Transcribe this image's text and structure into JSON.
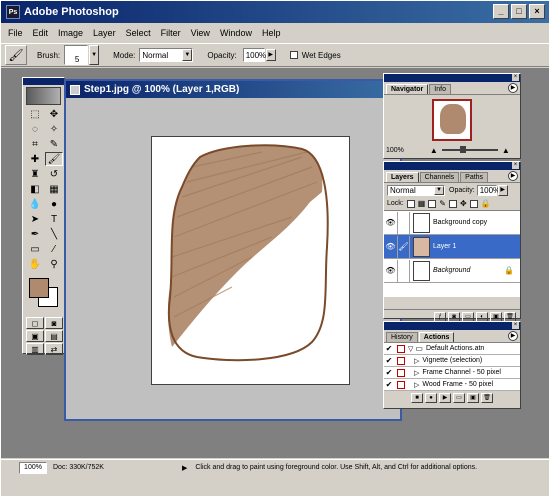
{
  "app": {
    "title": "Adobe Photoshop",
    "icon_label": "Ps"
  },
  "window_buttons": [
    "_",
    "□",
    "×"
  ],
  "menu": [
    "File",
    "Edit",
    "Image",
    "Layer",
    "Select",
    "Filter",
    "View",
    "Window",
    "Help"
  ],
  "options_bar": {
    "brush_label": "Brush:",
    "brush_size": "5",
    "mode_label": "Mode:",
    "mode_value": "Normal",
    "opacity_label": "Opacity:",
    "opacity_value": "100%",
    "wet_edges_label": "Wet Edges"
  },
  "document": {
    "title": "Step1.jpg @ 100% (Layer 1,RGB)"
  },
  "colors": {
    "foreground": "#b08a6e",
    "background": "#ffffff",
    "paint": "#b08a6e",
    "outline": "#7a4a2a"
  },
  "navigator": {
    "tabs": [
      "Navigator",
      "Info"
    ],
    "zoom": "100%"
  },
  "layers": {
    "tabs": [
      "Layers",
      "Channels",
      "Paths"
    ],
    "mode": "Normal",
    "opacity_label": "Opacity:",
    "opacity": "100%",
    "lock_label": "Lock:",
    "items": [
      {
        "name": "Background copy"
      },
      {
        "name": "Layer 1"
      },
      {
        "name": "Background"
      }
    ]
  },
  "actions": {
    "tabs": [
      "History",
      "Actions"
    ],
    "items": [
      {
        "name": "Default Actions.atn"
      },
      {
        "name": "Vignette (selection)"
      },
      {
        "name": "Frame Channel - 50 pixel"
      },
      {
        "name": "Wood Frame - 50 pixel"
      }
    ]
  },
  "status": {
    "zoom": "100%",
    "doc": "Doc: 330K/752K",
    "hint": "Click and drag to paint using foreground color. Use Shift, Alt, and Ctrl for additional options."
  }
}
